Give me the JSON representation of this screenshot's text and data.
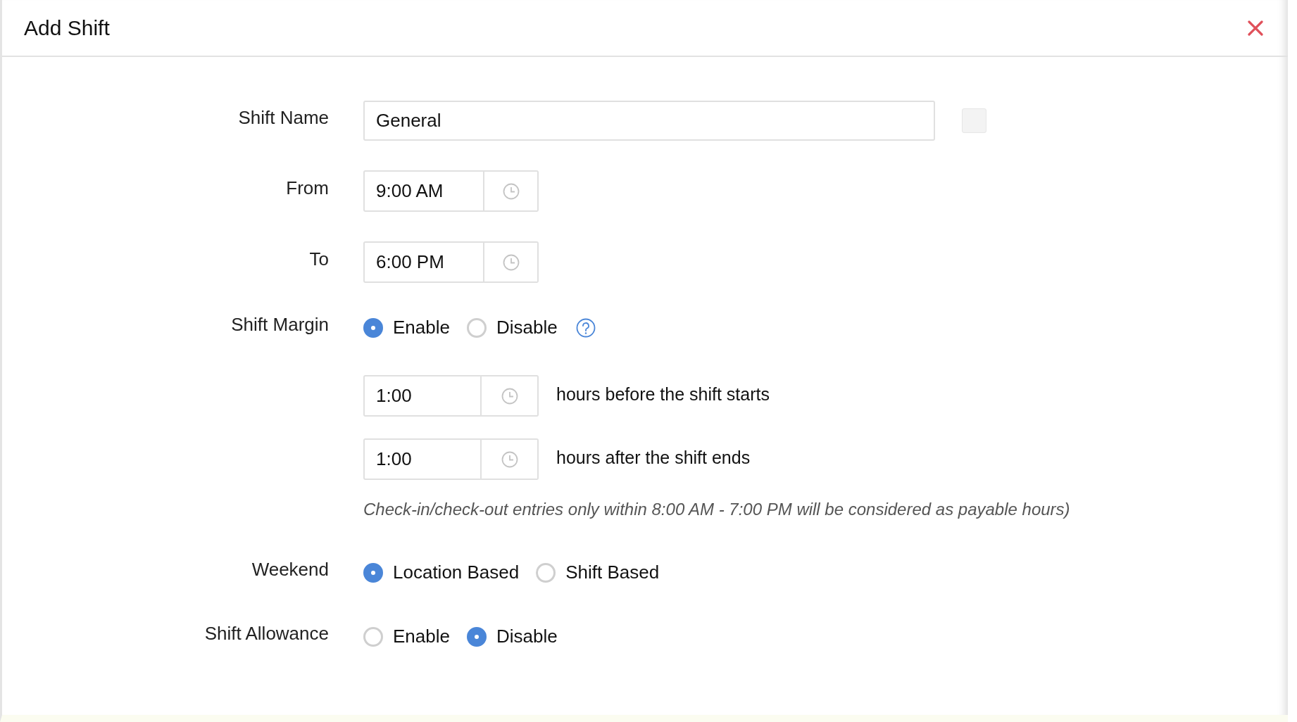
{
  "dialog": {
    "title": "Add Shift"
  },
  "form": [
    {
      "kind": "text",
      "label": "Shift Name",
      "value": "General"
    },
    {
      "kind": "time",
      "label": "From",
      "value": "9:00 AM"
    },
    {
      "kind": "time",
      "label": "To",
      "value": "6:00 PM"
    },
    {
      "kind": "radio",
      "label": "Shift Margin",
      "help": true,
      "options": [
        {
          "label": "Enable",
          "selected": true
        },
        {
          "label": "Disable",
          "selected": false
        }
      ]
    },
    {
      "kind": "offset",
      "value": "1:00",
      "caption": "hours before the shift starts"
    },
    {
      "kind": "offset",
      "value": "1:00",
      "caption": "hours after the shift ends"
    },
    {
      "kind": "note",
      "text": "Check-in/check-out entries only within 8:00 AM - 7:00 PM will be considered as payable hours)"
    },
    {
      "kind": "radio",
      "label": "Weekend",
      "options": [
        {
          "label": "Location Based",
          "selected": true
        },
        {
          "label": "Shift Based",
          "selected": false
        }
      ]
    },
    {
      "kind": "radio",
      "label": "Shift Allowance",
      "options": [
        {
          "label": "Enable",
          "selected": false
        },
        {
          "label": "Disable",
          "selected": true
        }
      ]
    }
  ]
}
